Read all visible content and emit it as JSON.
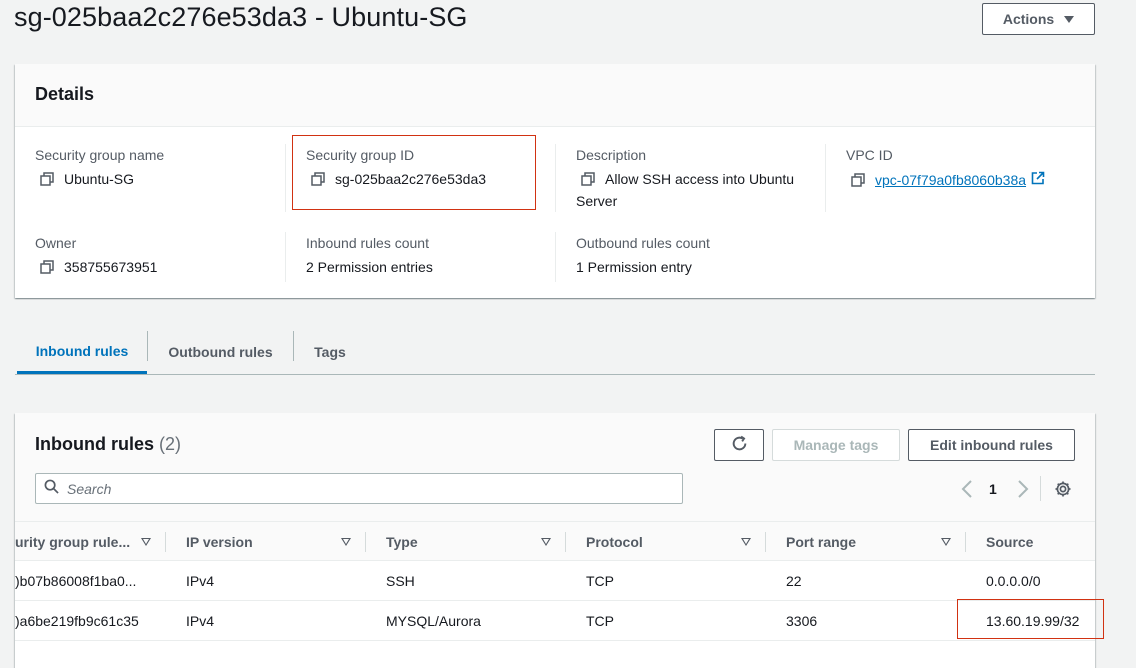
{
  "page": {
    "title": "sg-025baa2c276e53da3 - Ubuntu-SG",
    "actions_label": "Actions"
  },
  "details": {
    "title": "Details",
    "sg_name_label": "Security group name",
    "sg_name_value": "Ubuntu-SG",
    "sg_id_label": "Security group ID",
    "sg_id_value": "sg-025baa2c276e53da3",
    "description_label": "Description",
    "description_value": "Allow SSH access into Ubuntu Server",
    "vpc_id_label": "VPC ID",
    "vpc_id_value": "vpc-07f79a0fb8060b38a",
    "owner_label": "Owner",
    "owner_value": "358755673951",
    "inbound_count_label": "Inbound rules count",
    "inbound_count_value": "2 Permission entries",
    "outbound_count_label": "Outbound rules count",
    "outbound_count_value": "1 Permission entry"
  },
  "tabs": [
    {
      "label": "Inbound rules",
      "active": true
    },
    {
      "label": "Outbound rules",
      "active": false
    },
    {
      "label": "Tags",
      "active": false
    }
  ],
  "inbound": {
    "title": "Inbound rules",
    "count": "(2)",
    "manage_tags_label": "Manage tags",
    "edit_label": "Edit inbound rules",
    "search_placeholder": "Search",
    "page_number": "1",
    "columns": [
      "urity group rule...",
      "IP version",
      "Type",
      "Protocol",
      "Port range",
      "Source"
    ],
    "rows": [
      {
        "rule_id": ")b07b86008f1ba0...",
        "ip_version": "IPv4",
        "type": "SSH",
        "protocol": "TCP",
        "port_range": "22",
        "source": "0.0.0.0/0"
      },
      {
        "rule_id": ")a6be219fb9c61c35",
        "ip_version": "IPv4",
        "type": "MYSQL/Aurora",
        "protocol": "TCP",
        "port_range": "3306",
        "source": "13.60.19.99/32"
      }
    ]
  },
  "colors": {
    "accent": "#0073bb",
    "highlight": "#d13212",
    "background": "#f2f3f3"
  },
  "icons": [
    "copy-icon",
    "external-link-icon",
    "refresh-icon",
    "search-icon",
    "chevron-left-icon",
    "chevron-right-icon",
    "settings-gear-icon",
    "sort-descending-icon",
    "caret-down-icon"
  ]
}
